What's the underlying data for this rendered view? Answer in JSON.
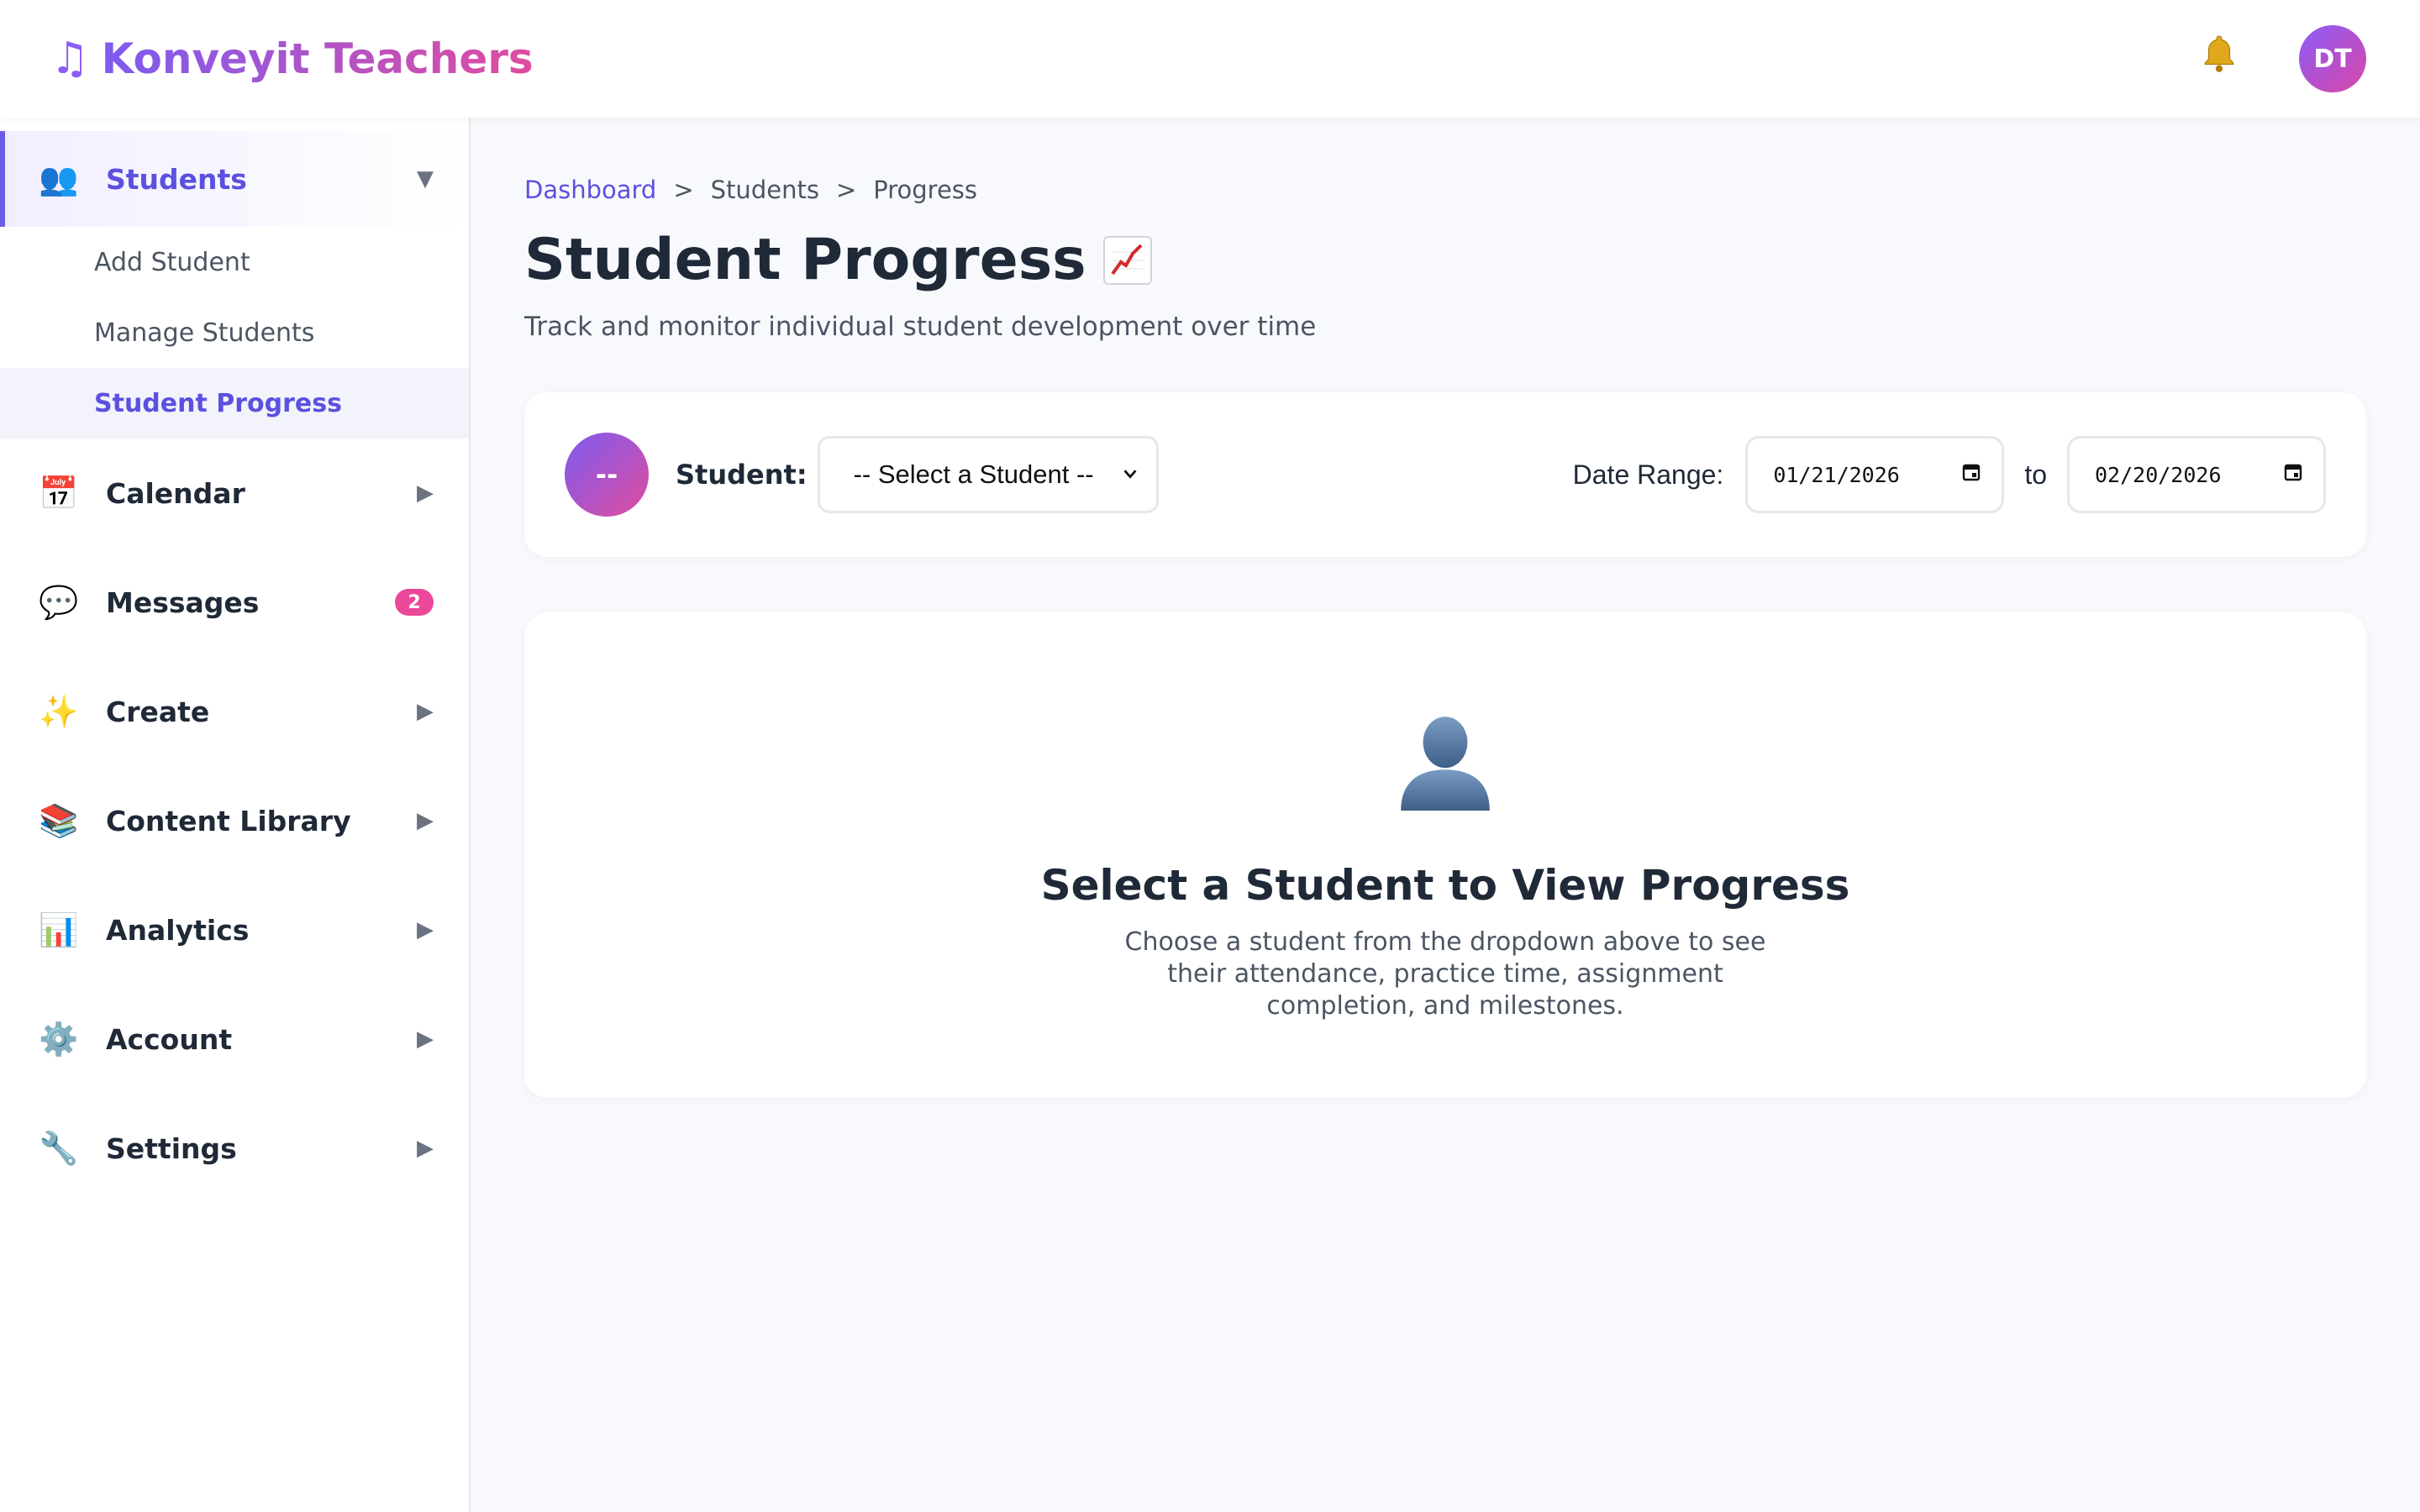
{
  "app": {
    "title": "Konveyit Teachers",
    "user_initials": "DT"
  },
  "colors": {
    "accent": "#5b50e0",
    "brand_gradient_start": "#7c5cf0",
    "brand_gradient_end": "#e04c9f",
    "badge": "#ec4899"
  },
  "sidebar": {
    "items": [
      {
        "label": "Students",
        "icon": "people-icon",
        "expanded": true,
        "submenu": [
          {
            "label": "Add Student"
          },
          {
            "label": "Manage Students"
          },
          {
            "label": "Student Progress",
            "active": true
          }
        ]
      },
      {
        "label": "Calendar",
        "icon": "calendar-icon"
      },
      {
        "label": "Messages",
        "icon": "speech-bubble-icon",
        "badge": "2"
      },
      {
        "label": "Create",
        "icon": "sparkles-icon"
      },
      {
        "label": "Content Library",
        "icon": "books-icon"
      },
      {
        "label": "Analytics",
        "icon": "bar-chart-icon"
      },
      {
        "label": "Account",
        "icon": "gear-icon"
      },
      {
        "label": "Settings",
        "icon": "wrench-icon"
      }
    ]
  },
  "breadcrumb": {
    "items": [
      "Dashboard",
      "Students",
      "Progress"
    ],
    "separator": ">"
  },
  "page": {
    "title": "Student Progress",
    "subtitle": "Track and monitor individual student development over time"
  },
  "filters": {
    "avatar_text": "--",
    "student_label": "Student:",
    "student_select_value": "-- Select a Student --",
    "date_range_label": "Date Range:",
    "date_from": "01/21/2026",
    "to_label": "to",
    "date_to": "02/20/2026"
  },
  "empty_state": {
    "title": "Select a Student to View Progress",
    "description": "Choose a student from the dropdown above to see their attendance, practice time, assignment completion, and milestones."
  }
}
